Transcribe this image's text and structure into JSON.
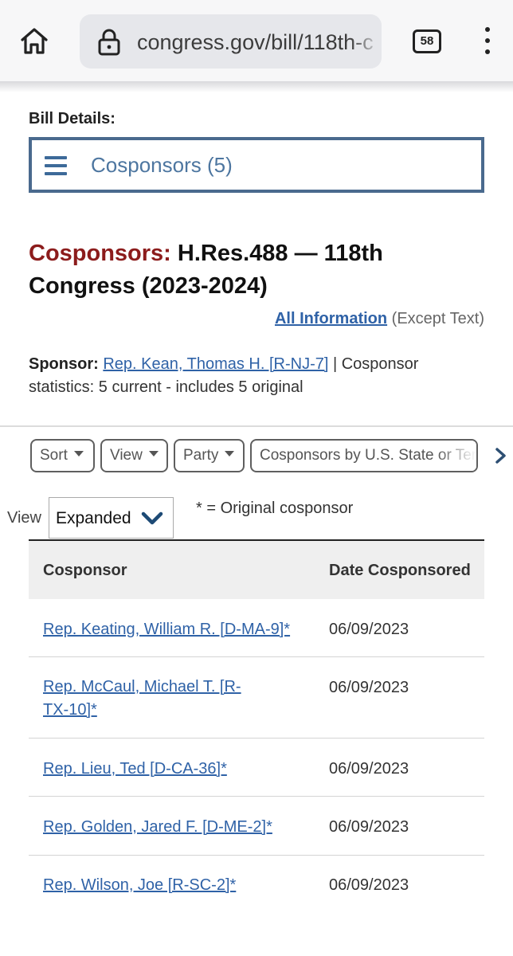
{
  "browser": {
    "url": "congress.gov/bill/118th-c",
    "tab_count": "58"
  },
  "bill_details": {
    "label": "Bill Details:",
    "section_selector": "Cosponsors (5)"
  },
  "heading": {
    "prefix": "Cosponsors:",
    "title": "H.Res.488 — 118th Congress (2023-2024)"
  },
  "all_information": {
    "link": "All Information",
    "suffix": "(Except Text)"
  },
  "sponsor": {
    "label": "Sponsor:",
    "name": "Rep. Kean, Thomas H. [R-NJ-7]",
    "stats": "| Cosponsor statistics: 5 current - includes 5 original"
  },
  "filters": {
    "sort": "Sort",
    "view": "View",
    "party": "Party",
    "state": "Cosponsors by U.S. State or Territory"
  },
  "view_control": {
    "label": "View",
    "value": "Expanded",
    "note": "* = Original cosponsor"
  },
  "table": {
    "headers": [
      "Cosponsor",
      "Date Cosponsored"
    ],
    "rows": [
      {
        "name": "Rep. Keating, William R. [D-MA-9]*",
        "date": "06/09/2023"
      },
      {
        "name": "Rep. McCaul, Michael T. [R-TX-10]*",
        "date": "06/09/2023"
      },
      {
        "name": "Rep. Lieu, Ted [D-CA-36]*",
        "date": "06/09/2023"
      },
      {
        "name": "Rep. Golden, Jared F. [D-ME-2]*",
        "date": "06/09/2023"
      },
      {
        "name": "Rep. Wilson, Joe [R-SC-2]*",
        "date": "06/09/2023"
      }
    ]
  },
  "colors": {
    "title_prefix": "#8c1c1c",
    "link": "#2f62a7",
    "selector_border": "#4a6a8e"
  }
}
